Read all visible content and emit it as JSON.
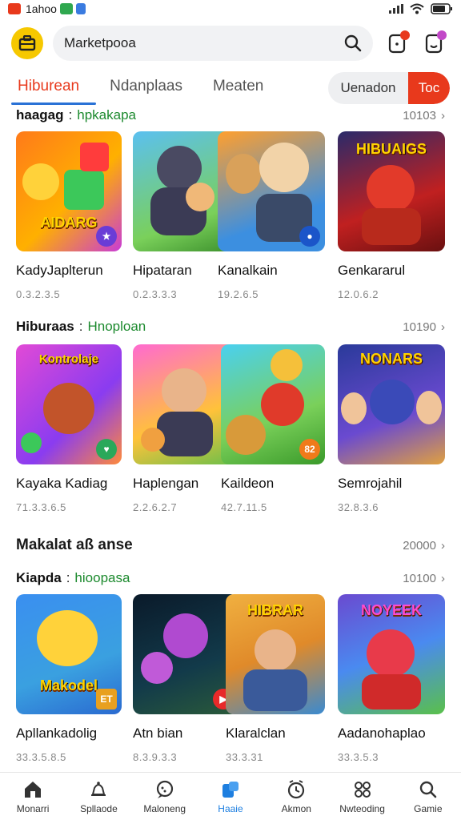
{
  "status_bar": {
    "time": "1ahoo"
  },
  "search": {
    "placeholder": "Marketpooa"
  },
  "tabs": [
    {
      "label": "Hiburean",
      "active": true
    },
    {
      "label": "Ndanplaas",
      "active": false
    },
    {
      "label": "Meaten",
      "active": false
    }
  ],
  "segment": {
    "left": "Uenadon",
    "right": "Toc"
  },
  "sections": [
    {
      "title": "haagag",
      "subtitle": "hpkakapa",
      "more": "10103",
      "cards": [
        {
          "name": "KadyJaplterun",
          "meta": "0.3.2.3.5",
          "art_text": "AIDARG",
          "corner": "★"
        },
        {
          "name": "Hipataran",
          "meta": "0.2.3.3.3",
          "art_text": "",
          "corner": ""
        },
        {
          "name": "Kanalkain",
          "meta": "19.2.6.5",
          "art_text": "",
          "corner": "●"
        },
        {
          "name": "Genkararul",
          "meta": "12.0.6.2",
          "art_text": "HIBUAIGS",
          "corner": ""
        }
      ]
    },
    {
      "title": "Hiburaas",
      "subtitle": "Hnoploan",
      "more": "10190",
      "cards": [
        {
          "name": "Kayaka Kadiag",
          "meta": "71.3.3.6.5",
          "art_text": "Kontrolaje",
          "corner": "♥"
        },
        {
          "name": "Haplengan",
          "meta": "2.2.6.2.7",
          "art_text": "",
          "corner": ""
        },
        {
          "name": "Kaildeon",
          "meta": "42.7.11.5",
          "art_text": "",
          "corner": "82"
        },
        {
          "name": "Semrojahil",
          "meta": "32.8.3.6",
          "art_text": "NONARS",
          "corner": ""
        }
      ]
    }
  ],
  "standalone": {
    "title": "Makalat aß anse",
    "more": "20000"
  },
  "section3": {
    "title": "Kiapda",
    "subtitle": "hioopasa",
    "more": "10100",
    "cards": [
      {
        "name": "Apllankadolig",
        "meta": "33.3.5.8.5",
        "art_text": "Makodel",
        "corner": "ET"
      },
      {
        "name": "Atn bian",
        "meta": "8.3.9.3.3",
        "art_text": "",
        "corner": "▶"
      },
      {
        "name": "Klaralclan",
        "meta": "33.3.31",
        "art_text": "HIBRAR",
        "corner": ""
      },
      {
        "name": "Aadanohaplao",
        "meta": "33.3.5.3",
        "art_text": "NOYEEK",
        "corner": ""
      }
    ]
  },
  "bottom_nav": [
    {
      "label": "Monarri",
      "icon": "home-icon"
    },
    {
      "label": "Spllaode",
      "icon": "bell-icon"
    },
    {
      "label": "Maloneng",
      "icon": "chat-icon"
    },
    {
      "label": "Haaie",
      "icon": "store-icon",
      "active": true
    },
    {
      "label": "Akmon",
      "icon": "clock-icon"
    },
    {
      "label": "Nwteoding",
      "icon": "apps-icon"
    },
    {
      "label": "Gamie",
      "icon": "search-icon"
    }
  ],
  "colors": {
    "accent": "#e8391c",
    "brand_yellow": "#f6c800",
    "tab_underline": "#2a72d6",
    "active_nav": "#1e7fe0",
    "subtitle_green": "#1c8a2e"
  }
}
